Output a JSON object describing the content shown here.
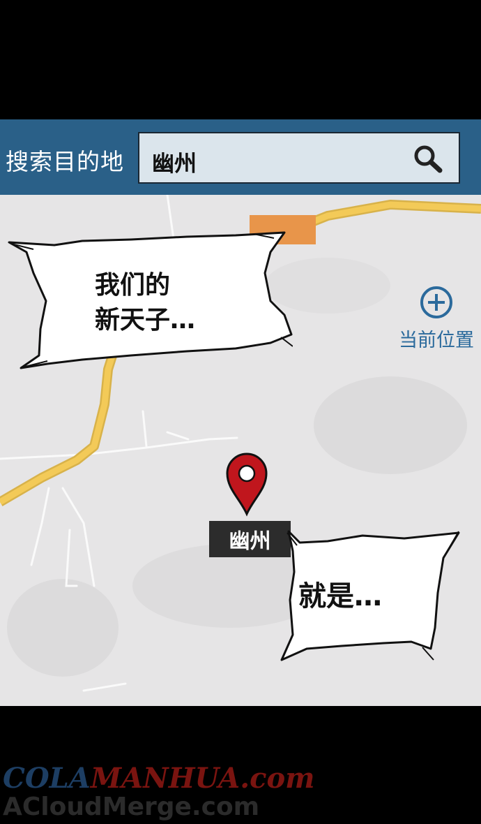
{
  "search": {
    "label": "搜索目的地",
    "value": "幽州"
  },
  "map": {
    "current_location_label": "当前位置",
    "place_label": "幽州"
  },
  "bubbles": {
    "top_line1": "我们的",
    "top_line2": "新天子…",
    "bottom": "就是…"
  },
  "watermark": {
    "line1_part1": "COLA",
    "line1_part2": "MANHUA.com",
    "line2": "ACloudMerge.com"
  },
  "colors": {
    "header": "#2a6088",
    "road": "#f1c553",
    "marker": "#c0161d",
    "poi": "#e8954a"
  }
}
